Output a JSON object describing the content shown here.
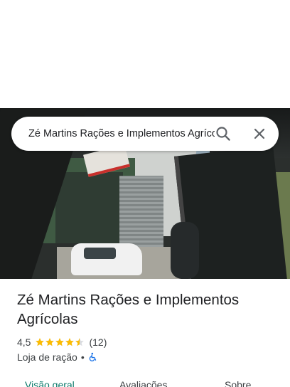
{
  "search": {
    "query": "Zé Martins Rações e Implementos Agrícolas"
  },
  "place": {
    "title": "Zé Martins Rações e Implementos Agrícolas",
    "rating": "4,5",
    "stars": 4.5,
    "reviews": "(12)",
    "category": "Loja de ração",
    "separator": "•"
  },
  "tabs": [
    {
      "label": "Visão geral",
      "active": true
    },
    {
      "label": "Avaliações",
      "active": false
    },
    {
      "label": "Sobre",
      "active": false
    }
  ],
  "colors": {
    "accent": "#0b7a6b",
    "star": "#fbbc04",
    "accessibility": "#1a73e8"
  },
  "icons": {
    "search": "search-icon",
    "close": "close-icon",
    "accessibility": "wheelchair-icon"
  }
}
